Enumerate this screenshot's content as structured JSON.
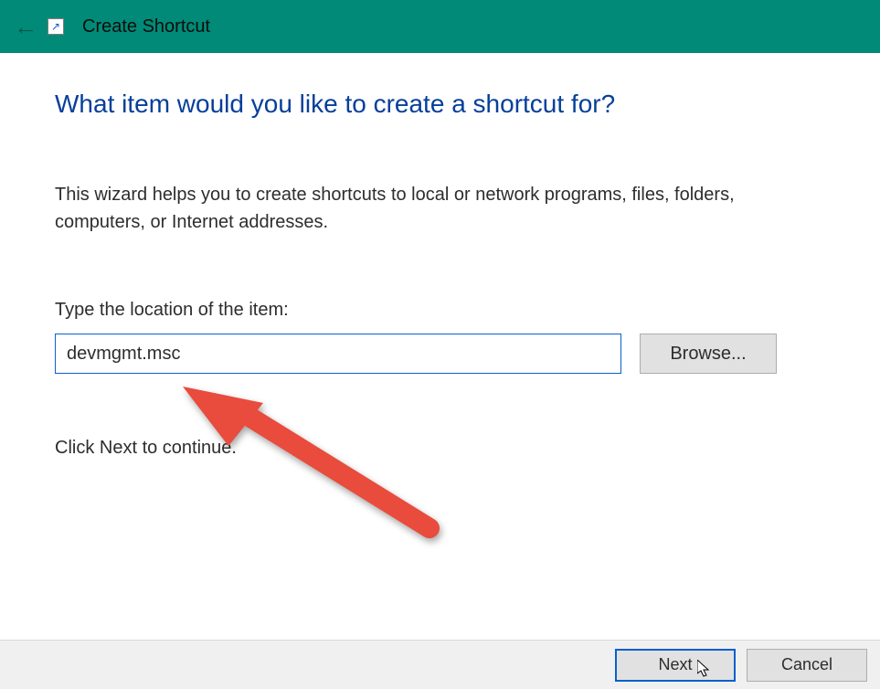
{
  "titlebar": {
    "title": "Create Shortcut"
  },
  "wizard": {
    "heading": "What item would you like to create a shortcut for?",
    "description": "This wizard helps you to create shortcuts to local or network programs, files, folders, computers, or Internet addresses.",
    "location_label": "Type the location of the item:",
    "location_value": "devmgmt.msc",
    "browse_label": "Browse...",
    "continue_text": "Click Next to continue."
  },
  "footer": {
    "next_label": "Next",
    "cancel_label": "Cancel"
  },
  "annotation": {
    "arrow_color": "#e94b3c"
  }
}
